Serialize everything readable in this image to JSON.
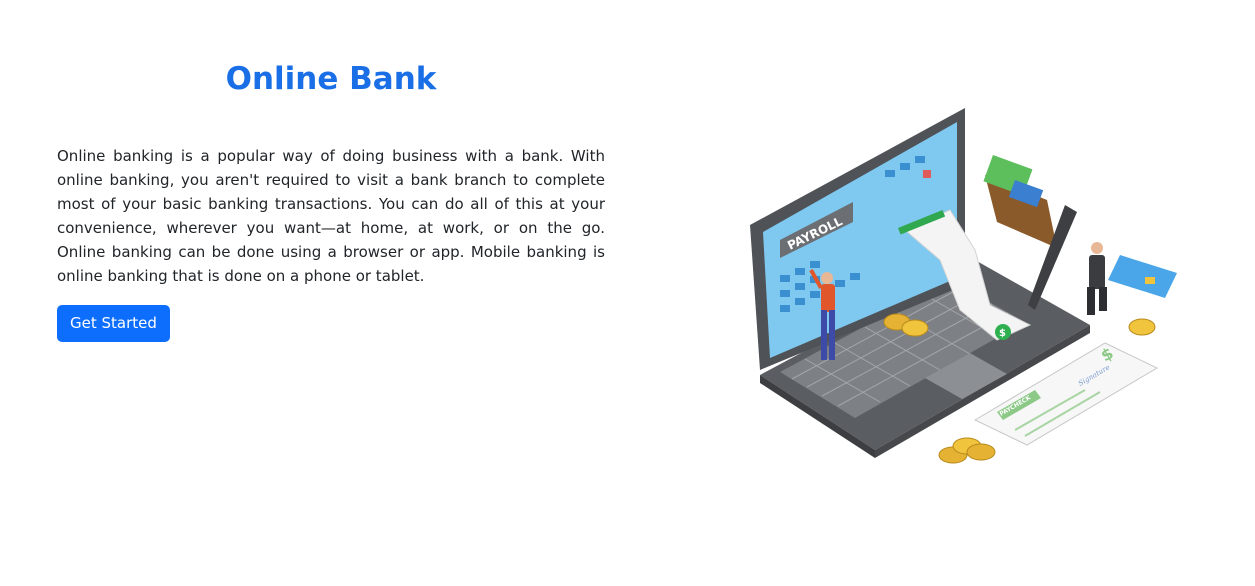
{
  "hero": {
    "title": "Online Bank",
    "description": "Online banking is a popular way of doing business with a bank. With online banking, you aren't required to visit a bank branch to complete most of your basic banking transactions. You can do all of this at your convenience, wherever you want—at home, at work, or on the go. Online banking can be done using a browser or app. Mobile banking is online banking that is done on a phone or tablet.",
    "button_label": "Get Started"
  },
  "illustration": {
    "screen_label": "PAYROLL",
    "check_label": "PAYCHECK",
    "signature": "Signature",
    "currency_symbol": "$"
  },
  "colors": {
    "title": "#1a6fe6",
    "button": "#0d6efd",
    "text": "#212529"
  }
}
